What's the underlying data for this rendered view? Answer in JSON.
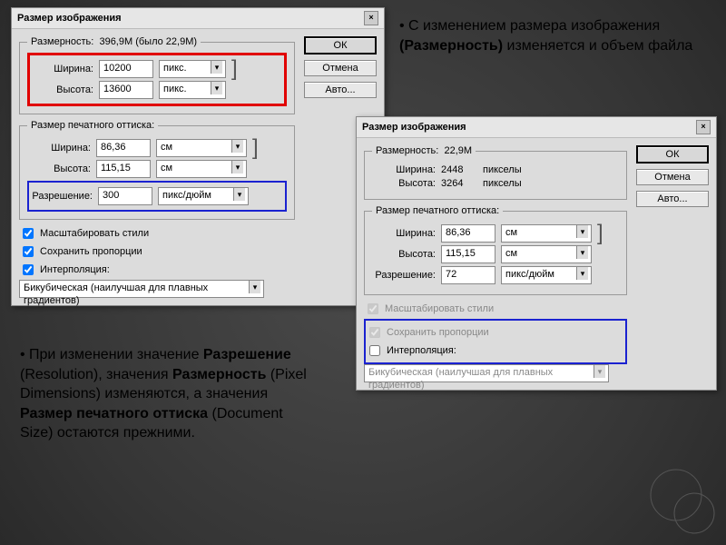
{
  "dialog_title": "Размер изображения",
  "buttons": {
    "ok": "ОК",
    "cancel": "Отмена",
    "auto": "Авто..."
  },
  "groupA": {
    "pixel_dims_legend": "Размерность:",
    "pixel_dims_value": "396,9M (было 22,9M)",
    "width_label": "Ширина:",
    "height_label": "Высота:",
    "width_val": "10200",
    "height_val": "13600",
    "unit_pix": "пикс.",
    "print_legend": "Размер печатного оттиска:",
    "print_width": "86,36",
    "print_height": "115,15",
    "unit_cm": "см",
    "res_label": "Разрешение:",
    "res_val": "300",
    "unit_res": "пикс/дюйм"
  },
  "checks": {
    "scale": "Масштабировать стили",
    "proportions": "Сохранить пропорции",
    "interp": "Интерполяция:",
    "interp_method": "Бикубическая (наилучшая для плавных градиентов)"
  },
  "groupB": {
    "pixel_dims_value": "22,9M",
    "width_val": "2448",
    "height_val": "3264",
    "unit_pix": "пикселы",
    "print_width": "86,36",
    "print_height": "115,15",
    "unit_cm": "см",
    "res_val": "72",
    "unit_res": "пикс/дюйм"
  },
  "note1_pre": "С изменением размера изображения ",
  "note1_bold": "(Размерность)",
  "note1_post": " изменяется и объем файла",
  "note2_pre": "При изменении значение ",
  "note2_a": "Разрешение",
  "note2_a2": " (Resolution), значения ",
  "note2_b": "Размерность",
  "note2_b2": " (Pixel Dimensions) изменяются, а значения ",
  "note2_c": "Размер печатного оттиска",
  "note2_c2": " (Document Size) остаются прежними."
}
